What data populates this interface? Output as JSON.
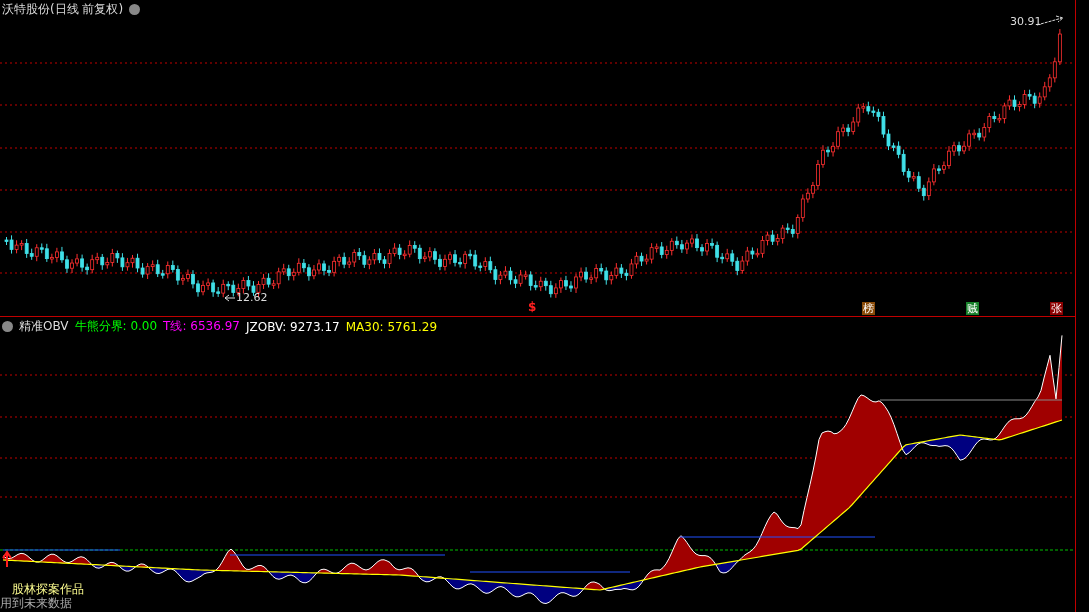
{
  "price_panel": {
    "title": "沃特股份(日线 前复权)",
    "price_labels": [
      {
        "text": "30.91",
        "kind": "high"
      },
      {
        "text": "12.62",
        "kind": "low"
      }
    ],
    "signals": [
      {
        "text": "$",
        "kind": "plain",
        "color": "#ff2020"
      },
      {
        "text": "榜",
        "kind": "badge",
        "color": "#8a4b08"
      },
      {
        "text": "贼",
        "kind": "badge",
        "color": "#17802a"
      },
      {
        "text": "张",
        "kind": "badge",
        "color": "#8b0000"
      }
    ]
  },
  "indicator_panel": {
    "name": "精准OBV",
    "values": [
      {
        "label": "牛熊分界:",
        "value": "0.00",
        "color": "#00ff00"
      },
      {
        "label": "T线:",
        "value": "6536.97",
        "color": "#ff00ff"
      },
      {
        "label": "JZOBV:",
        "value": "9273.17",
        "color": "#ffffff"
      },
      {
        "label": "MA30:",
        "value": "5761.29",
        "color": "#ffff00"
      }
    ],
    "credit": "股林探案作品",
    "note": "用到未来数据"
  }
}
